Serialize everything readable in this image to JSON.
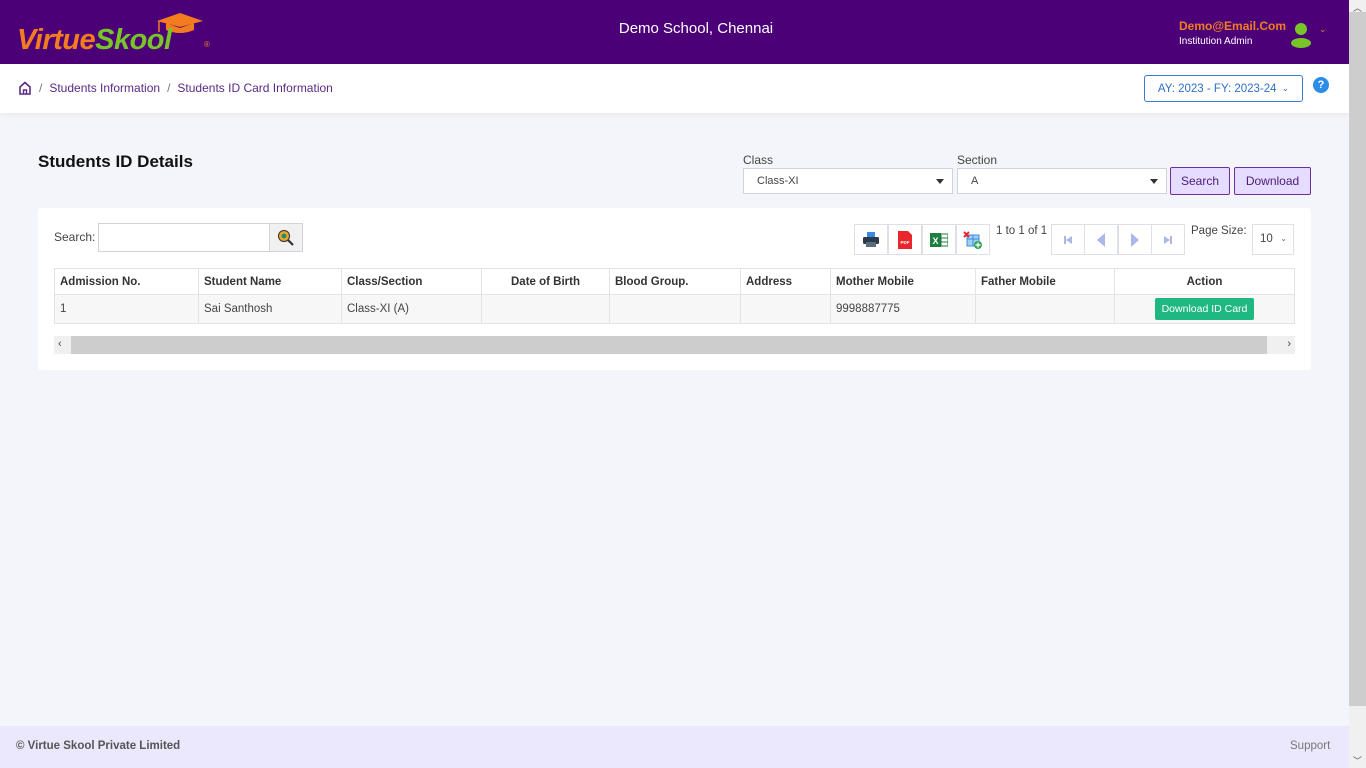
{
  "header": {
    "logo_part1": "Virtue",
    "logo_part2": "Skool",
    "logo_reg": "®",
    "school_name": "Demo School, Chennai",
    "user_email": "Demo@Email.Com",
    "user_role": "Institution Admin"
  },
  "breadcrumb": {
    "items": [
      "Students Information",
      "Students ID Card Information"
    ],
    "separator": "/"
  },
  "year_selector": {
    "value": "AY: 2023 - FY: 2023-24",
    "chevron": "⌄"
  },
  "help": {
    "label": "?"
  },
  "page": {
    "title": "Students ID Details"
  },
  "filters": {
    "class_label": "Class",
    "class_value": "Class-XI",
    "section_label": "Section",
    "section_value": "A",
    "search_button": "Search",
    "download_button": "Download"
  },
  "grid": {
    "search_label": "Search:",
    "search_value": "",
    "page_info": "1 to 1 of 1",
    "page_size_label": "Page Size:",
    "page_size_value": "10",
    "columns": [
      "Admission No.",
      "Student Name",
      "Class/Section",
      "Date of Birth",
      "Blood Group.",
      "Address",
      "Mother Mobile",
      "Father Mobile",
      "Action"
    ],
    "rows": [
      {
        "admission_no": "1",
        "student_name": "Sai Santhosh",
        "class_section": "Class-XI (A)",
        "dob": "",
        "blood_group": "",
        "address": "",
        "mother_mobile": "9998887775",
        "father_mobile": "",
        "action_label": "Download ID Card"
      }
    ]
  },
  "footer": {
    "copyright": "© Virtue Skool Private Limited",
    "support": "Support"
  },
  "colors": {
    "header_bg": "#4b0078",
    "brand_orange": "#f47c20",
    "brand_green": "#79c428",
    "action_green": "#1fb883",
    "footer_bg": "#ebe7fd"
  }
}
